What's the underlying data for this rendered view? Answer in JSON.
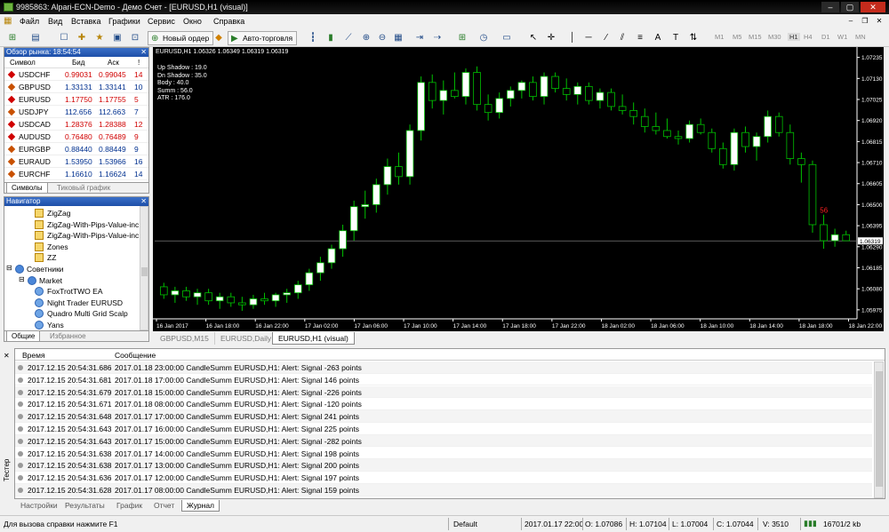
{
  "window": {
    "title": "9985863: Alpari-ECN-Demo - Демо Счет - [EURUSD,H1 (visual)]",
    "controls": [
      "–",
      "▢",
      "✕"
    ]
  },
  "menu": [
    "Файл",
    "Вид",
    "Вставка",
    "Графики",
    "Сервис",
    "Окно",
    "Справка"
  ],
  "toolbar": {
    "new_order": "Новый ордер",
    "autotrading": "Авто-торговля",
    "timeframes": [
      "M1",
      "M5",
      "M15",
      "M30",
      "H1",
      "H4",
      "D1",
      "W1",
      "MN"
    ],
    "active_timeframe": "H1"
  },
  "market_watch": {
    "title": "Обзор рынка: 18:54:54",
    "columns": {
      "symbol": "Символ",
      "bid": "Бид",
      "ask": "Аск",
      "spread": "!"
    },
    "rows": [
      {
        "symbol": "USDCHF",
        "bid": "0.99031",
        "ask": "0.99045",
        "spread": "14",
        "dir": "down"
      },
      {
        "symbol": "GBPUSD",
        "bid": "1.33131",
        "ask": "1.33141",
        "spread": "10",
        "dir": "up"
      },
      {
        "symbol": "EURUSD",
        "bid": "1.17750",
        "ask": "1.17755",
        "spread": "5",
        "dir": "down"
      },
      {
        "symbol": "USDJPY",
        "bid": "112.656",
        "ask": "112.663",
        "spread": "7",
        "dir": "up"
      },
      {
        "symbol": "USDCAD",
        "bid": "1.28376",
        "ask": "1.28388",
        "spread": "12",
        "dir": "down"
      },
      {
        "symbol": "AUDUSD",
        "bid": "0.76480",
        "ask": "0.76489",
        "spread": "9",
        "dir": "down"
      },
      {
        "symbol": "EURGBP",
        "bid": "0.88440",
        "ask": "0.88449",
        "spread": "9",
        "dir": "up"
      },
      {
        "symbol": "EURAUD",
        "bid": "1.53950",
        "ask": "1.53966",
        "spread": "16",
        "dir": "up"
      },
      {
        "symbol": "EURCHF",
        "bid": "1.16610",
        "ask": "1.16624",
        "spread": "14",
        "dir": "up"
      }
    ],
    "tabs": [
      "Символы",
      "Тиковый график"
    ]
  },
  "navigator": {
    "title": "Навигатор",
    "items": [
      {
        "label": "ZigZag",
        "kind": "indicator",
        "level": 2
      },
      {
        "label": "ZigZag-With-Pips-Value-inc",
        "kind": "indicator",
        "level": 2
      },
      {
        "label": "ZigZag-With-Pips-Value-inc",
        "kind": "indicator",
        "level": 2
      },
      {
        "label": "Zones",
        "kind": "indicator",
        "level": 2
      },
      {
        "label": "ZZ",
        "kind": "indicator",
        "level": 2
      },
      {
        "label": "Советники",
        "kind": "folder",
        "level": 0
      },
      {
        "label": "Market",
        "kind": "folder",
        "level": 1
      },
      {
        "label": "FoxTrotTWO EA",
        "kind": "ea",
        "level": 2
      },
      {
        "label": "Night Trader EURUSD",
        "kind": "ea",
        "level": 2
      },
      {
        "label": "Quadro Multi Grid Scalp",
        "kind": "ea",
        "level": 2
      },
      {
        "label": "Yans",
        "kind": "ea",
        "level": 2
      }
    ],
    "tabs": [
      "Общие",
      "Избранное"
    ]
  },
  "chart": {
    "header": "EURUSD,H1  1.06326 1.06349 1.06319 1.06319",
    "info": [
      "Up Shadow : 19.0",
      "Dn Shadow : 35.0",
      "Body : 40.0",
      "Summ : 56.0",
      "ATR : 176.0"
    ],
    "signal_label": "56",
    "current_price": "1.06319",
    "colors": {
      "bull": "#ffffff",
      "bear": "#000000",
      "wick": "#00c000",
      "grid": "#404040",
      "axis": "#ffffff"
    }
  },
  "chart_data": {
    "type": "candlestick",
    "title": "EURUSD,H1",
    "x_ticks": [
      "16 Jan 2017",
      "16 Jan 18:00",
      "16 Jan 22:00",
      "17 Jan 02:00",
      "17 Jan 06:00",
      "17 Jan 10:00",
      "17 Jan 14:00",
      "17 Jan 18:00",
      "17 Jan 22:00",
      "18 Jan 02:00",
      "18 Jan 06:00",
      "18 Jan 10:00",
      "18 Jan 14:00",
      "18 Jan 18:00",
      "18 Jan 22:00"
    ],
    "y_ticks": [
      "1.07235",
      "1.07130",
      "1.07025",
      "1.06920",
      "1.06815",
      "1.06710",
      "1.06605",
      "1.06500",
      "1.06395",
      "1.06290",
      "1.06185",
      "1.06080",
      "1.05975"
    ],
    "ylim": [
      1.0593,
      1.0726
    ],
    "candles": [
      [
        1.0609,
        1.0611,
        1.0603,
        1.0605
      ],
      [
        1.0605,
        1.0609,
        1.0601,
        1.0607
      ],
      [
        1.0607,
        1.0609,
        1.0602,
        1.0604
      ],
      [
        1.0604,
        1.0608,
        1.06,
        1.0606
      ],
      [
        1.0606,
        1.0608,
        1.06,
        1.0602
      ],
      [
        1.0602,
        1.0606,
        1.0598,
        1.0604
      ],
      [
        1.0604,
        1.0606,
        1.0599,
        1.0601
      ],
      [
        1.0601,
        1.0604,
        1.0597,
        1.06
      ],
      [
        1.06,
        1.0605,
        1.0598,
        1.0603
      ],
      [
        1.0603,
        1.0606,
        1.06,
        1.0602
      ],
      [
        1.0602,
        1.0606,
        1.0599,
        1.0605
      ],
      [
        1.0605,
        1.0608,
        1.0601,
        1.0606
      ],
      [
        1.0606,
        1.0612,
        1.0603,
        1.061
      ],
      [
        1.061,
        1.0618,
        1.0607,
        1.0616
      ],
      [
        1.0616,
        1.0624,
        1.0612,
        1.0621
      ],
      [
        1.0621,
        1.063,
        1.0618,
        1.0628
      ],
      [
        1.0628,
        1.064,
        1.0624,
        1.0637
      ],
      [
        1.0637,
        1.0652,
        1.0632,
        1.0649
      ],
      [
        1.0649,
        1.0657,
        1.0643,
        1.065
      ],
      [
        1.065,
        1.0663,
        1.0646,
        1.066
      ],
      [
        1.066,
        1.0673,
        1.0655,
        1.0669
      ],
      [
        1.0669,
        1.0676,
        1.066,
        1.0664
      ],
      [
        1.0664,
        1.069,
        1.066,
        1.0687
      ],
      [
        1.0687,
        1.0714,
        1.0682,
        1.0711
      ],
      [
        1.0711,
        1.0715,
        1.0698,
        1.0702
      ],
      [
        1.0702,
        1.0712,
        1.0695,
        1.0707
      ],
      [
        1.0707,
        1.0716,
        1.0703,
        1.0704
      ],
      [
        1.0704,
        1.0718,
        1.07,
        1.0716
      ],
      [
        1.0716,
        1.0719,
        1.0697,
        1.07
      ],
      [
        1.07,
        1.0705,
        1.0692,
        1.0696
      ],
      [
        1.0696,
        1.0706,
        1.0693,
        1.0703
      ],
      [
        1.0703,
        1.0709,
        1.0699,
        1.0707
      ],
      [
        1.0707,
        1.0712,
        1.0703,
        1.0711
      ],
      [
        1.0711,
        1.0714,
        1.0702,
        1.0704
      ],
      [
        1.0704,
        1.0716,
        1.07,
        1.0714
      ],
      [
        1.0714,
        1.0716,
        1.0706,
        1.0708
      ],
      [
        1.0708,
        1.0713,
        1.0702,
        1.0705
      ],
      [
        1.0705,
        1.0711,
        1.07,
        1.0709
      ],
      [
        1.0709,
        1.0711,
        1.07,
        1.0702
      ],
      [
        1.0702,
        1.0708,
        1.0698,
        1.0706
      ],
      [
        1.0706,
        1.0708,
        1.0697,
        1.0699
      ],
      [
        1.0699,
        1.0705,
        1.0695,
        1.0697
      ],
      [
        1.0697,
        1.0701,
        1.069,
        1.0694
      ],
      [
        1.0694,
        1.0698,
        1.0686,
        1.0689
      ],
      [
        1.0689,
        1.0696,
        1.0685,
        1.0687
      ],
      [
        1.0687,
        1.0693,
        1.0683,
        1.0684
      ],
      [
        1.0684,
        1.0687,
        1.068,
        1.0683
      ],
      [
        1.0683,
        1.0692,
        1.0681,
        1.069
      ],
      [
        1.069,
        1.0693,
        1.0685,
        1.0686
      ],
      [
        1.0686,
        1.0688,
        1.0676,
        1.0678
      ],
      [
        1.0678,
        1.0681,
        1.0668,
        1.067
      ],
      [
        1.067,
        1.0688,
        1.0667,
        1.0686
      ],
      [
        1.0686,
        1.0689,
        1.0676,
        1.0679
      ],
      [
        1.0679,
        1.0686,
        1.0672,
        1.0684
      ],
      [
        1.0684,
        1.0697,
        1.0681,
        1.0694
      ],
      [
        1.0694,
        1.0696,
        1.0684,
        1.0686
      ],
      [
        1.0686,
        1.069,
        1.067,
        1.0673
      ],
      [
        1.0673,
        1.0676,
        1.0661,
        1.067
      ],
      [
        1.067,
        1.0672,
        1.0636,
        1.064
      ],
      [
        1.064,
        1.0645,
        1.0628,
        1.0632
      ],
      [
        1.0632,
        1.0638,
        1.0629,
        1.0635
      ],
      [
        1.0635,
        1.0637,
        1.0632,
        1.0632
      ]
    ]
  },
  "chart_tabs": [
    "GBPUSD,M15",
    "EURUSD,Daily",
    "EURUSD,H1 (visual)"
  ],
  "terminal": {
    "columns": {
      "time": "Время",
      "message": "Сообщение"
    },
    "rows": [
      {
        "time": "2017.12.15 20:54:31.686",
        "message": "2017.01.18 23:00:00  CandleSumm EURUSD,H1: Alert: Signal -263 points"
      },
      {
        "time": "2017.12.15 20:54:31.681",
        "message": "2017.01.18 17:00:00  CandleSumm EURUSD,H1: Alert: Signal 146 points"
      },
      {
        "time": "2017.12.15 20:54:31.679",
        "message": "2017.01.18 15:00:00  CandleSumm EURUSD,H1: Alert: Signal -226 points"
      },
      {
        "time": "2017.12.15 20:54:31.671",
        "message": "2017.01.18 08:00:00  CandleSumm EURUSD,H1: Alert: Signal -120 points"
      },
      {
        "time": "2017.12.15 20:54:31.648",
        "message": "2017.01.17 17:00:00  CandleSumm EURUSD,H1: Alert: Signal 241 points"
      },
      {
        "time": "2017.12.15 20:54:31.643",
        "message": "2017.01.17 16:00:00  CandleSumm EURUSD,H1: Alert: Signal 225 points"
      },
      {
        "time": "2017.12.15 20:54:31.643",
        "message": "2017.01.17 15:00:00  CandleSumm EURUSD,H1: Alert: Signal -282 points"
      },
      {
        "time": "2017.12.15 20:54:31.638",
        "message": "2017.01.17 14:00:00  CandleSumm EURUSD,H1: Alert: Signal 198 points"
      },
      {
        "time": "2017.12.15 20:54:31.638",
        "message": "2017.01.17 13:00:00  CandleSumm EURUSD,H1: Alert: Signal 200 points"
      },
      {
        "time": "2017.12.15 20:54:31.636",
        "message": "2017.01.17 12:00:00  CandleSumm EURUSD,H1: Alert: Signal 197 points"
      },
      {
        "time": "2017.12.15 20:54:31.628",
        "message": "2017.01.17 08:00:00  CandleSumm EURUSD,H1: Alert: Signal 159 points"
      }
    ],
    "tabs": [
      "Настройки",
      "Результаты",
      "График",
      "Отчет",
      "Журнал"
    ],
    "active_tab": "Журнал",
    "side_label": "Тестер"
  },
  "status": {
    "hint": "Для вызова справки нажмите F1",
    "profile": "Default",
    "datetime": "2017.01.17 22:00",
    "open": "O: 1.07086",
    "high": "H: 1.07104",
    "low": "L: 1.07004",
    "close": "C: 1.07044",
    "volume": "V: 3510",
    "traffic": "16701/2 kb"
  }
}
